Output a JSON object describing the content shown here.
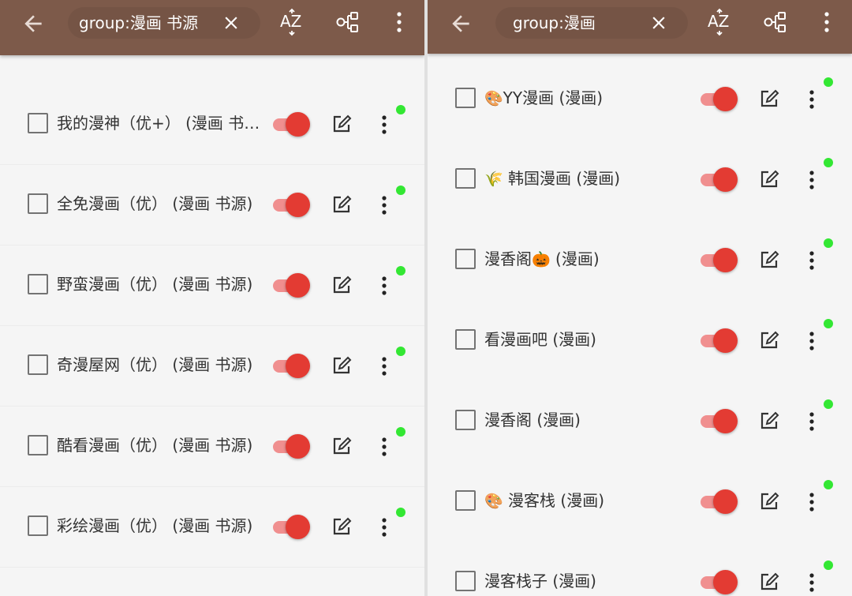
{
  "left_panel": {
    "search_text": "group:漫画 书源",
    "rows": [
      {
        "name": "我的漫神（优+） (漫画 书源)"
      },
      {
        "name": "全免漫画（优） (漫画 书源)"
      },
      {
        "name": "野蛮漫画（优） (漫画 书源)"
      },
      {
        "name": "奇漫屋网（优） (漫画 书源)"
      },
      {
        "name": "酷看漫画（优） (漫画 书源)"
      },
      {
        "name": "彩绘漫画（优） (漫画 书源)"
      }
    ]
  },
  "right_panel": {
    "search_text": "group:漫画",
    "rows": [
      {
        "emoji": "🎨",
        "name": "YY漫画 (漫画)"
      },
      {
        "emoji": "🌾",
        "name": " 韩国漫画 (漫画)"
      },
      {
        "name": "漫香阁",
        "emoji_after": "🎃",
        "suffix": " (漫画)"
      },
      {
        "name": "看漫画吧 (漫画)"
      },
      {
        "name": "漫香阁 (漫画)"
      },
      {
        "emoji": "🎨",
        "name": " 漫客栈 (漫画)"
      },
      {
        "name": "漫客栈子 (漫画)"
      }
    ]
  },
  "colors": {
    "toolbar": "#7d5a4a",
    "toggle_thumb": "#e33b33",
    "toggle_track": "#f08f8f",
    "status_dot": "#33e733"
  },
  "icons": {
    "back": "arrow-left-icon",
    "clear": "close-icon",
    "sort": "sort-az-icon",
    "group": "group-icon",
    "menu": "more-vert-icon",
    "edit": "edit-icon"
  }
}
